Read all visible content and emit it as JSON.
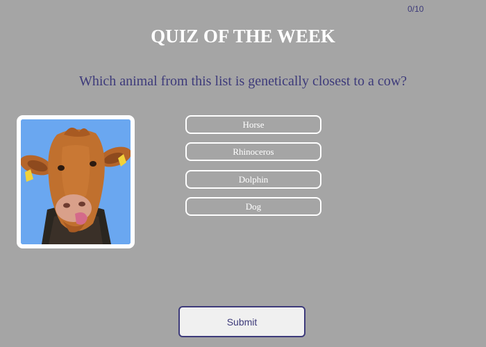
{
  "quiz": {
    "progress": "0/10",
    "title": "QUIZ OF THE WEEK",
    "question": "Which animal from this list is genetically closest to a cow?",
    "image": {
      "icon": "cow-photo"
    },
    "answers": [
      {
        "label": "Horse"
      },
      {
        "label": "Rhinoceros"
      },
      {
        "label": "Dolphin"
      },
      {
        "label": "Dog"
      }
    ],
    "submit_label": "Submit"
  },
  "colors": {
    "background": "#a5a5a5",
    "accent": "#3d3a7a",
    "title": "#ffffff",
    "answer_border": "#ffffff",
    "submit_bg": "#f0f0f0"
  }
}
